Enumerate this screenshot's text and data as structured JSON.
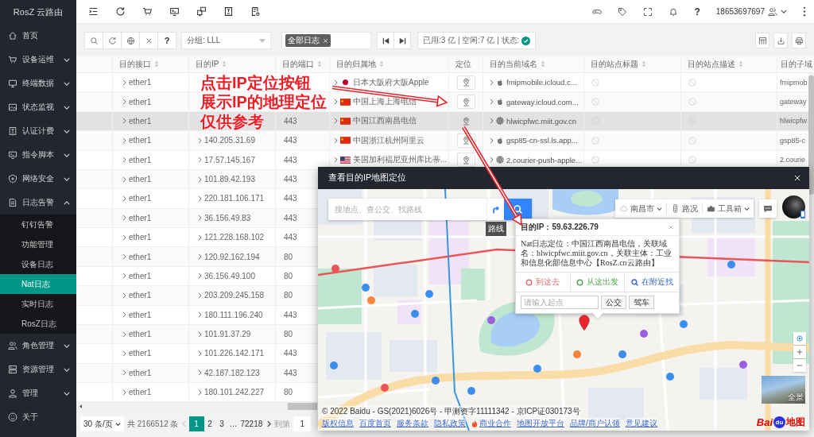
{
  "sidebar": {
    "logo": "RosZ 云路由",
    "items": [
      {
        "label": "首页"
      },
      {
        "label": "设备运维",
        "expanded": false
      },
      {
        "label": "终端数据",
        "expanded": false
      },
      {
        "label": "状态监视",
        "expanded": false
      },
      {
        "label": "认证计费",
        "expanded": false
      },
      {
        "label": "指令脚本",
        "expanded": false
      },
      {
        "label": "网络安全",
        "expanded": false
      },
      {
        "label": "日志告警",
        "expanded": true,
        "children": [
          {
            "label": "钉钉告警",
            "selected": false
          },
          {
            "label": "功能管理",
            "selected": false
          },
          {
            "label": "设备日志",
            "selected": false
          },
          {
            "label": "Nat日志",
            "selected": true
          },
          {
            "label": "实时日志",
            "selected": false
          },
          {
            "label": "RosZ日志",
            "selected": false
          }
        ]
      },
      {
        "label": "角色管理",
        "expanded": false
      },
      {
        "label": "资源管理",
        "expanded": false
      },
      {
        "label": "管理",
        "expanded": false
      },
      {
        "label": "关于"
      }
    ]
  },
  "header": {
    "help": "?",
    "user": "18653697697"
  },
  "toolbar": {
    "help": "?",
    "group_select": "分组: LLL",
    "log_tags": [
      "全部日志"
    ],
    "status": "已用:3 亿 | 空闲:7 亿 | 状态:",
    "status_ok": true
  },
  "table": {
    "columns": [
      {
        "label": "目的接口",
        "sortable": true
      },
      {
        "label": "目的IP",
        "sortable": true
      },
      {
        "label": "目的端口",
        "sortable": true
      },
      {
        "label": "目的归属地",
        "sortable": true
      },
      {
        "label": "定位",
        "sortable": false
      },
      {
        "label": "目的当前域名",
        "sortable": true
      },
      {
        "label": "目的站点标题",
        "sortable": true
      },
      {
        "label": "目的站点描述",
        "sortable": true
      },
      {
        "label": "目的子域",
        "sortable": false
      }
    ],
    "rows": [
      {
        "interface": "ether1",
        "location": {
          "text": "日本大阪府大阪Apple",
          "kind": "jp"
        },
        "domain": {
          "text": "fmipmobile.icloud.c...",
          "kind": "apple"
        },
        "site_title": {
          "kind": "empty"
        },
        "site_description": {
          "kind": "empty"
        },
        "subdomain": "fmipmob",
        "selected": false
      },
      {
        "interface": "ether1",
        "location": {
          "text": "中国上海上海电信",
          "kind": "cn"
        },
        "domain": {
          "text": "gateway.icloud.com...",
          "kind": "apple"
        },
        "site_title": {
          "kind": "empty"
        },
        "site_description": {
          "kind": "empty"
        },
        "subdomain": "gateway",
        "selected": false
      },
      {
        "interface": "ether1",
        "port": "443",
        "location": {
          "text": "中国江西南昌电信",
          "kind": "cn"
        },
        "domain": {
          "text": "hlwicpfwc.miit.gov.cn",
          "kind": "globe"
        },
        "site_title": {
          "kind": "empty"
        },
        "site_description": {
          "kind": "empty"
        },
        "subdomain": "hlwicpfw",
        "selected": true
      },
      {
        "interface": "ether1",
        "ip": "140.205.31.69",
        "port": "443",
        "location": {
          "text": "中国浙江杭州阿里云",
          "kind": "cn"
        },
        "domain": {
          "text": "gsp85-cn-ssl.ls.app...",
          "kind": "apple"
        },
        "site_title": {
          "kind": "empty"
        },
        "site_description": {
          "kind": "empty"
        },
        "subdomain": "gsp85-c",
        "selected": false
      },
      {
        "interface": "ether1",
        "ip": "17.57.145.167",
        "port": "443",
        "location": {
          "text": "美国加利福尼亚州库比蒂...",
          "kind": "us"
        },
        "domain": {
          "text": "2.courier-push-apple...",
          "kind": "globe"
        },
        "site_title": {
          "kind": "empty"
        },
        "site_description": {
          "kind": "empty"
        },
        "subdomain": "2.courie",
        "selected": false
      },
      {
        "interface": "ether1",
        "ip": "101.89.42.193",
        "port": "443",
        "selected": false
      },
      {
        "interface": "ether1",
        "ip": "220.181.106.171",
        "port": "443",
        "selected": false
      },
      {
        "interface": "ether1",
        "ip": "36.156.49.83",
        "port": "443",
        "selected": false
      },
      {
        "interface": "ether1",
        "ip": "121.228.168.102",
        "port": "443",
        "selected": false
      },
      {
        "interface": "ether1",
        "ip": "120.92.162.194",
        "port": "80",
        "selected": false
      },
      {
        "interface": "ether1",
        "ip": "36.156.49.100",
        "port": "80",
        "selected": false
      },
      {
        "interface": "ether1",
        "ip": "203.209.245.158",
        "port": "80",
        "selected": false
      },
      {
        "interface": "ether1",
        "ip": "180.111.196.240",
        "port": "443",
        "selected": false
      },
      {
        "interface": "ether1",
        "ip": "101.91.37.29",
        "port": "80",
        "selected": false
      },
      {
        "interface": "ether1",
        "ip": "101.226.142.171",
        "port": "443",
        "selected": false
      },
      {
        "interface": "ether1",
        "ip": "42.187.182.123",
        "port": "443",
        "selected": false
      },
      {
        "interface": "ether1",
        "ip": "180.101.242.227",
        "port": "80",
        "selected": false
      }
    ]
  },
  "pagination": {
    "page_size": "30 条/页",
    "total": "共 2166512 条",
    "prev_disabled": true,
    "pages": [
      {
        "label": "1",
        "kind": "page",
        "selected": true
      },
      {
        "label": "2",
        "kind": "page",
        "selected": false
      },
      {
        "label": "3",
        "kind": "page",
        "selected": false
      },
      {
        "label": "…",
        "kind": "ellipsis"
      },
      {
        "label": "72218",
        "kind": "page",
        "selected": false
      }
    ],
    "goto_label": "到第",
    "goto_value": "1"
  },
  "annotation": {
    "lines": [
      "点击IP定位按钮",
      "展示IP的地理定位",
      "仅供参考"
    ]
  },
  "map_dialog": {
    "title": "查看目的IP地图定位",
    "search": {
      "placeholder": "搜地点、查公交、找路线"
    },
    "route_tooltip": "路线",
    "city": "南昌市",
    "traffic": "路况",
    "toolbox": "工具箱",
    "info_window": {
      "title": "目的IP：59.63.226.79",
      "body": "Nat日志定位：中国江西南昌电信，关联域名：hlwicpfwc.miit.gov.cn，关联主体：工业和信息化部信息中心【RosZ.cn云路由】",
      "actions": [
        {
          "label": "到这去",
          "kind": "to"
        },
        {
          "label": "从这出发",
          "kind": "from"
        },
        {
          "label": "在附近找",
          "kind": "nearby"
        }
      ],
      "start": {
        "placeholder": "请输入起点"
      },
      "buttons": [
        "公交",
        "驾车"
      ]
    },
    "street_view": "全景",
    "copyright": "© 2022 Baidu - GS(2021)6026号 - 甲测资字11111342 - 京ICP证030173号",
    "links": [
      {
        "label": "版权信息",
        "kind": "plain"
      },
      {
        "label": "百度首页",
        "kind": "plain"
      },
      {
        "label": "服务条款",
        "kind": "plain"
      },
      {
        "label": "隐私政策",
        "kind": "plain"
      },
      {
        "label": "商业合作",
        "kind": "hot"
      },
      {
        "label": "地图开放平台",
        "kind": "plain"
      },
      {
        "label": "品牌/商户认领",
        "kind": "plain"
      },
      {
        "label": "意见建议",
        "kind": "plain"
      }
    ],
    "logo": [
      "Bai",
      "du",
      "地图"
    ]
  }
}
